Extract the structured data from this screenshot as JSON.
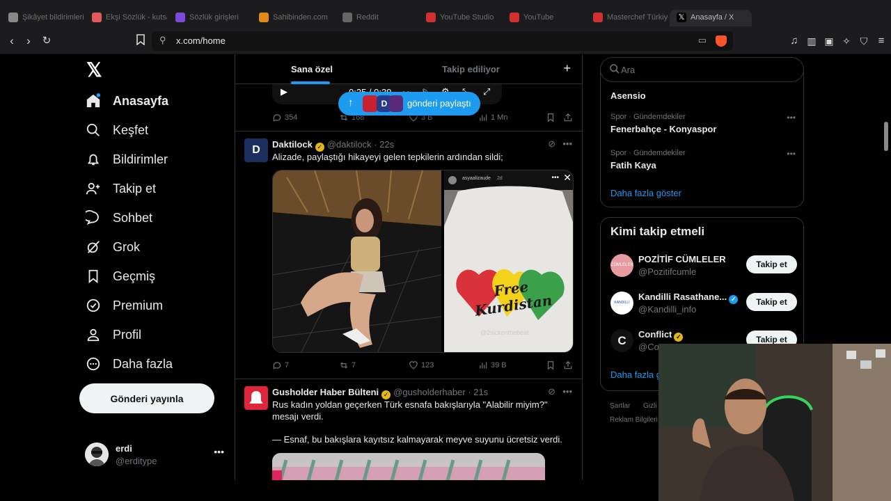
{
  "browser": {
    "tabs": [
      {
        "title": "Şikâyet bildirimleri",
        "color": "#888888"
      },
      {
        "title": "Ekşi Sözlük - kutsal bilgi",
        "color": "#e05c5c"
      },
      {
        "title": "Sözlük girişleri",
        "color": "#7a4ad9"
      },
      {
        "title": "Sahibinden.com",
        "color": "#e08a1e"
      },
      {
        "title": "Reddit",
        "color": "#666666"
      },
      {
        "title": "YouTube Studio",
        "color": "#d03030"
      },
      {
        "title": "YouTube",
        "color": "#d03030"
      },
      {
        "title": "Masterchef Türkiye",
        "color": "#d03030"
      },
      {
        "title": "Anasayfa / X",
        "color": "#ffffff"
      }
    ],
    "url": "x.com/home"
  },
  "nav": {
    "items": [
      {
        "label": "Anasayfa",
        "icon": "home-icon"
      },
      {
        "label": "Keşfet",
        "icon": "search-icon"
      },
      {
        "label": "Bildirimler",
        "icon": "bell-icon"
      },
      {
        "label": "Takip et",
        "icon": "follow-icon"
      },
      {
        "label": "Sohbet",
        "icon": "chat-icon"
      },
      {
        "label": "Grok",
        "icon": "grok-icon"
      },
      {
        "label": "Geçmiş",
        "icon": "bookmark-icon"
      },
      {
        "label": "Premium",
        "icon": "premium-icon"
      },
      {
        "label": "Profil",
        "icon": "profile-icon"
      },
      {
        "label": "Daha fazla",
        "icon": "more-icon"
      }
    ],
    "post_button": "Gönderi yayınla",
    "account": {
      "name": "erdi",
      "handle": "@erditype"
    }
  },
  "feed": {
    "tabs": [
      "Sana özel",
      "Takip ediliyor"
    ],
    "video": {
      "time": "0:25 / 0:39"
    },
    "new_posts_pill": "gönderi paylaştı",
    "post0_stats": {
      "replies": "354",
      "reposts": "168",
      "likes": "3 B",
      "views": "1 Mn"
    },
    "posts": [
      {
        "name": "Daktilock",
        "handle": "@daktilock",
        "time": "· 22s",
        "text": "Alizade, paylaştığı hikayeyi gelen tepkilerin ardından sildi;",
        "story": {
          "user": "asyaalizaude",
          "age": "2d",
          "shirt_text": "Free Kurdistan",
          "shirt_handle": "@2sickonthebeat"
        },
        "stats": {
          "replies": "7",
          "reposts": "7",
          "likes": "123",
          "views": "39 B"
        }
      },
      {
        "name": "Gusholder Haber Bülteni",
        "handle": "@gusholderhaber",
        "time": "· 21s",
        "text1": "Rus kadın yoldan geçerken Türk esnafa bakışlarıyla \"Alabilir miyim?\" mesajı verdi.",
        "text2": "— Esnaf, bu bakışlara kayıtsız kalmayarak meyve suyunu ücretsiz verdi."
      }
    ]
  },
  "sidebar": {
    "search_placeholder": "Ara",
    "trends": [
      {
        "category": "",
        "name": "Asensio"
      },
      {
        "category": "Spor · Gündemdekiler",
        "name": "Fenerbahçe - Konyaspor"
      },
      {
        "category": "Spor · Gündemdekiler",
        "name": "Fatih Kaya"
      }
    ],
    "trends_more": "Daha fazla göster",
    "who_to_follow": "Kimi takip etmeli",
    "suggestions": [
      {
        "name": "POZİTİF CÜMLELER",
        "handle": "@Pozitifcumle",
        "button": "Takip et"
      },
      {
        "name": "Kandilli Rasathane...",
        "handle": "@Kandilli_info",
        "button": "Takip et"
      },
      {
        "name": "Conflict",
        "handle": "@Co",
        "button": "Takip et"
      }
    ],
    "wtf_more": "Daha fazla g",
    "footer": [
      "Şartlar",
      "Gizli",
      "Reklam Bilgileri"
    ]
  }
}
